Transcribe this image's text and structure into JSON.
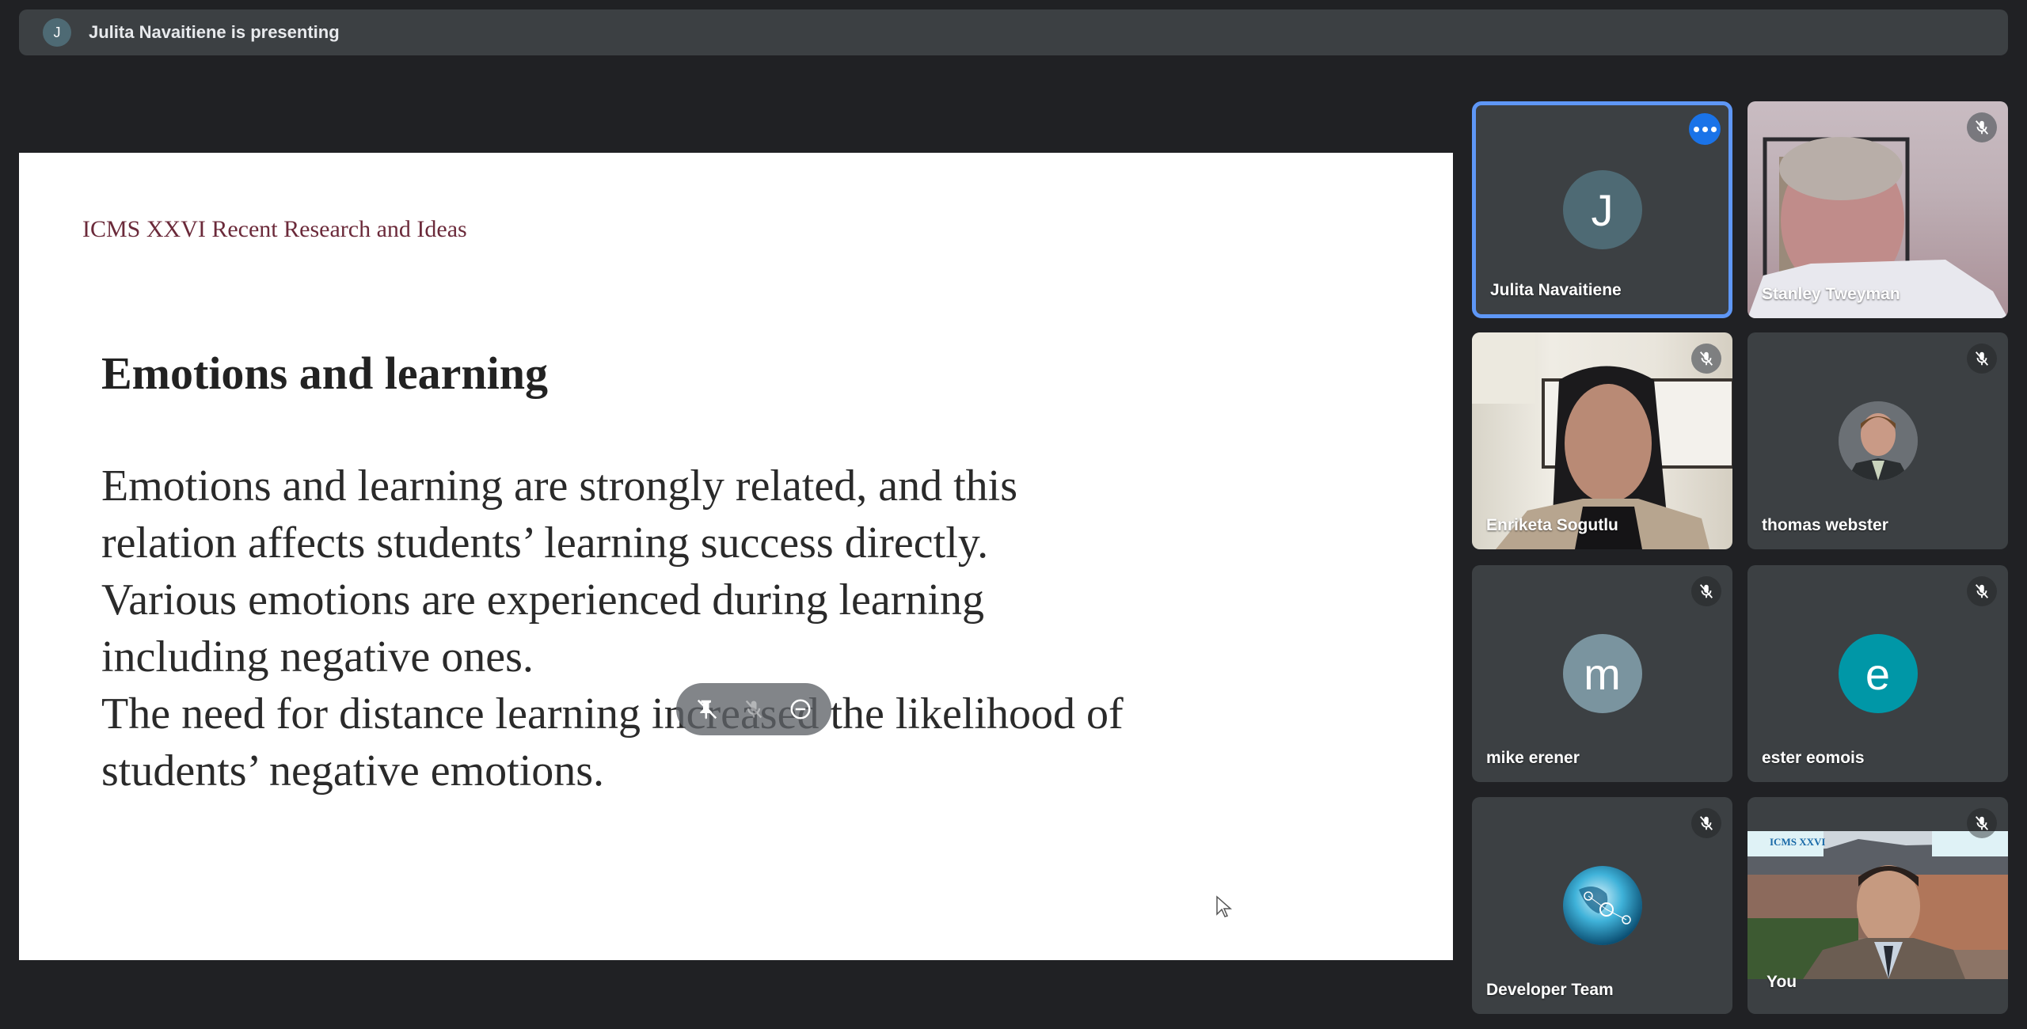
{
  "banner": {
    "avatar_initial": "J",
    "text": "Julita Navaitiene is presenting"
  },
  "slide": {
    "header": "ICMS XXVI Recent Research and Ideas",
    "title": "Emotions and learning",
    "body_lines": [
      "Emotions and learning are strongly related, and this",
      "relation affects students’ learning success directly.",
      "Various emotions are experienced during learning",
      "including negative ones.",
      "The need for distance learning increased the likelihood of",
      "students’ negative emotions."
    ],
    "overlay": {
      "icons": [
        "unpin-icon",
        "mic-off-icon",
        "remove-icon"
      ]
    }
  },
  "participants": [
    {
      "name": "Julita Navaitiene",
      "initial": "J",
      "avatar_color": "#4e6a74",
      "type": "avatar",
      "active": true,
      "control": "more-options"
    },
    {
      "name": "Stanley Tweyman",
      "type": "video",
      "muted": true
    },
    {
      "name": "Enriketa Sogutlu",
      "type": "video",
      "muted": true
    },
    {
      "name": "thomas webster",
      "type": "photo",
      "muted": true
    },
    {
      "name": "mike erener",
      "initial": "m",
      "avatar_color": "#7a949f",
      "type": "avatar",
      "muted": true
    },
    {
      "name": "ester eomois",
      "initial": "e",
      "avatar_color": "#0097a7",
      "type": "avatar",
      "muted": true
    },
    {
      "name": "Developer Team",
      "type": "photo",
      "muted": true
    },
    {
      "name": "You",
      "type": "video",
      "muted": true,
      "background_label": "ICMS XXVI"
    }
  ],
  "colors": {
    "background": "#202124",
    "surface": "#3c4043",
    "active_border": "#5e97f6",
    "accent": "#1a73e8"
  }
}
